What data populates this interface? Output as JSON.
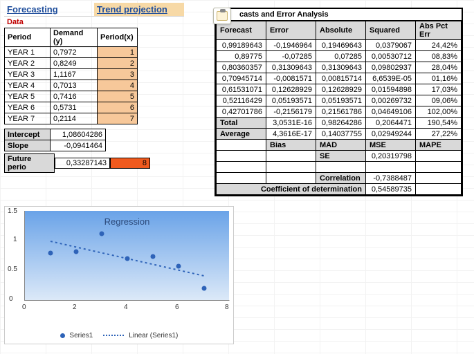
{
  "header": {
    "forecasting": "Forecasting",
    "trend": "Trend projection"
  },
  "data_label": "Data",
  "left_headers": {
    "period": "Period",
    "demand": "Demand (y)",
    "px": "Period(x)"
  },
  "left_rows": [
    {
      "period": "YEAR 1",
      "demand": "0,7972",
      "px": "1"
    },
    {
      "period": "YEAR 2",
      "demand": "0,8249",
      "px": "2"
    },
    {
      "period": "YEAR 3",
      "demand": "1,1167",
      "px": "3"
    },
    {
      "period": "YEAR 4",
      "demand": "0,7013",
      "px": "4"
    },
    {
      "period": "YEAR 5",
      "demand": "0,7416",
      "px": "5"
    },
    {
      "period": "YEAR 6",
      "demand": "0,5731",
      "px": "6"
    },
    {
      "period": "YEAR 7",
      "demand": "0,2114",
      "px": "7"
    }
  ],
  "intercept": {
    "label": "Intercept",
    "value": "1,08604286"
  },
  "slope": {
    "label": "Slope",
    "value": "-0,0941464"
  },
  "future": {
    "label": "Future perio",
    "value": "0,33287143",
    "px": "8"
  },
  "right_title": "casts and Error Analysis",
  "right_headers": {
    "forecast": "Forecast",
    "error": "Error",
    "absolute": "Absolute",
    "squared": "Squared",
    "pct": "Abs Pct Err"
  },
  "right_rows": [
    {
      "forecast": "0,99189643",
      "error": "-0,1946964",
      "absolute": "0,19469643",
      "squared": "0,0379067",
      "pct": "24,42%"
    },
    {
      "forecast": "0,89775",
      "error": "-0,07285",
      "absolute": "0,07285",
      "squared": "0,00530712",
      "pct": "08,83%"
    },
    {
      "forecast": "0,80360357",
      "error": "0,31309643",
      "absolute": "0,31309643",
      "squared": "0,09802937",
      "pct": "28,04%"
    },
    {
      "forecast": "0,70945714",
      "error": "-0,0081571",
      "absolute": "0,00815714",
      "squared": "6,6539E-05",
      "pct": "01,16%"
    },
    {
      "forecast": "0,61531071",
      "error": "0,12628929",
      "absolute": "0,12628929",
      "squared": "0,01594898",
      "pct": "17,03%"
    },
    {
      "forecast": "0,52116429",
      "error": "0,05193571",
      "absolute": "0,05193571",
      "squared": "0,00269732",
      "pct": "09,06%"
    },
    {
      "forecast": "0,42701786",
      "error": "-0,2156179",
      "absolute": "0,21561786",
      "squared": "0,04649106",
      "pct": "102,00%"
    }
  ],
  "total": {
    "label": "Total",
    "error": "3,0531E-16",
    "absolute": "0,98264286",
    "squared": "0,2064471",
    "pct": "190,54%"
  },
  "average": {
    "label": "Average",
    "error": "4,3616E-17",
    "absolute": "0,14037755",
    "squared": "0,02949244",
    "pct": "27,22%"
  },
  "metric_labels": {
    "bias": "Bias",
    "mad": "MAD",
    "mse": "MSE",
    "mape": "MAPE",
    "se": "SE"
  },
  "se_value": "0,20319798",
  "correlation": {
    "label": "Correlation",
    "value": "-0,7388487"
  },
  "coef": {
    "label": "Coefficient of determination",
    "value": "0,54589735"
  },
  "chart_data": {
    "type": "scatter",
    "title": "Regression",
    "x": [
      1,
      2,
      3,
      4,
      5,
      6,
      7
    ],
    "y": [
      0.7972,
      0.8249,
      1.1167,
      0.7013,
      0.7416,
      0.5731,
      0.2114
    ],
    "trend": {
      "type": "linear",
      "intercept": 1.08604286,
      "slope": -0.0941464
    },
    "xlim": [
      0,
      8
    ],
    "ylim": [
      0,
      1.5
    ],
    "yticks": [
      0,
      0.5,
      1,
      1.5
    ],
    "xticks": [
      0,
      2,
      4,
      6,
      8
    ],
    "series_name": "Series1",
    "trend_name": "Linear (Series1)"
  }
}
